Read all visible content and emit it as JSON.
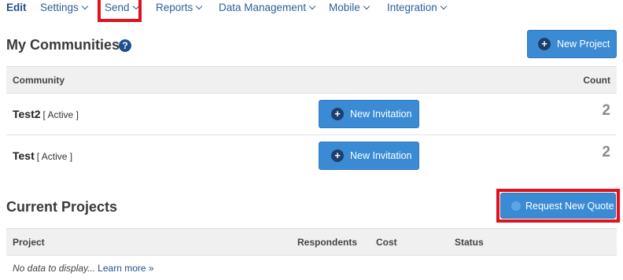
{
  "nav": {
    "edit": "Edit",
    "settings": "Settings",
    "send": "Send",
    "reports": "Reports",
    "data_management": "Data Management",
    "mobile": "Mobile",
    "integration": "Integration"
  },
  "communities": {
    "title": "My Communities",
    "help_icon": "?",
    "new_project_label": "New Project",
    "headers": {
      "community": "Community",
      "count": "Count"
    },
    "rows": [
      {
        "name": "Test2",
        "status": "[ Active ]",
        "invite_label": "New Invitation",
        "count": "2"
      },
      {
        "name": "Test",
        "status": "[ Active ]",
        "invite_label": "New Invitation",
        "count": "2"
      }
    ]
  },
  "projects": {
    "title": "Current Projects",
    "request_quote_label": "Request New Quote",
    "headers": {
      "project": "Project",
      "respondents": "Respondents",
      "cost": "Cost",
      "status": "Status"
    },
    "empty_text": "No data to display...",
    "learn_more": "Learn more »"
  },
  "icons": {
    "plus": "+",
    "chevron": "chevron-down-icon"
  },
  "colors": {
    "accent": "#3b8bd4",
    "highlight": "#e0121d",
    "link": "#2c5f9a"
  }
}
